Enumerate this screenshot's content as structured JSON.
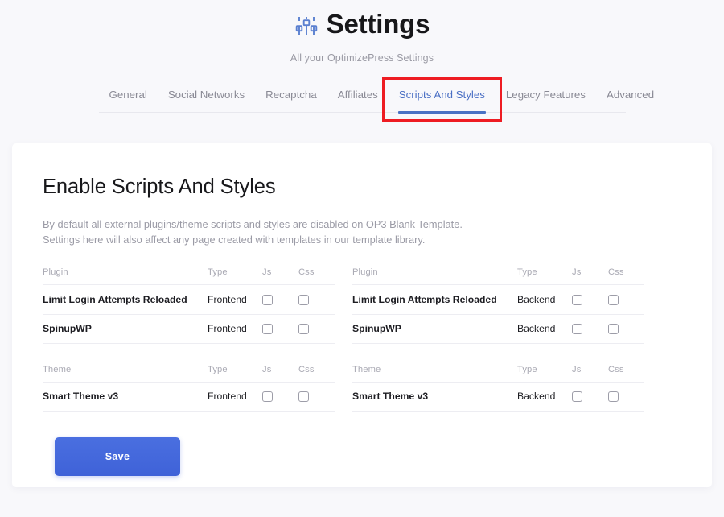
{
  "header": {
    "icon": "sliders-icon",
    "title": "Settings",
    "subtitle": "All your OptimizePress Settings"
  },
  "tabs": [
    {
      "label": "General",
      "active": false
    },
    {
      "label": "Social Networks",
      "active": false
    },
    {
      "label": "Recaptcha",
      "active": false
    },
    {
      "label": "Affiliates",
      "active": false
    },
    {
      "label": "Scripts And Styles",
      "active": true
    },
    {
      "label": "Legacy Features",
      "active": false
    },
    {
      "label": "Advanced",
      "active": false
    }
  ],
  "highlight": {
    "target_tab": "Scripts And Styles",
    "color": "#ee1c23"
  },
  "main": {
    "section_title": "Enable Scripts And Styles",
    "description_line1": "By default all external plugins/theme scripts and styles are disabled on OP3 Blank Template.",
    "description_line2": "Settings here will also affect any page created with templates in our template library.",
    "save_label": "Save",
    "columns": {
      "left": {
        "plugin_table": {
          "headers": [
            "Plugin",
            "Type",
            "Js",
            "Css"
          ],
          "rows": [
            {
              "name": "Limit Login Attempts Reloaded",
              "type": "Frontend",
              "js": false,
              "css": false
            },
            {
              "name": "SpinupWP",
              "type": "Frontend",
              "js": false,
              "css": false
            }
          ]
        },
        "theme_table": {
          "headers": [
            "Theme",
            "Type",
            "Js",
            "Css"
          ],
          "rows": [
            {
              "name": "Smart Theme v3",
              "type": "Frontend",
              "js": false,
              "css": false
            }
          ]
        }
      },
      "right": {
        "plugin_table": {
          "headers": [
            "Plugin",
            "Type",
            "Js",
            "Css"
          ],
          "rows": [
            {
              "name": "Limit Login Attempts Reloaded",
              "type": "Backend",
              "js": false,
              "css": false
            },
            {
              "name": "SpinupWP",
              "type": "Backend",
              "js": false,
              "css": false
            }
          ]
        },
        "theme_table": {
          "headers": [
            "Theme",
            "Type",
            "Js",
            "Css"
          ],
          "rows": [
            {
              "name": "Smart Theme v3",
              "type": "Backend",
              "js": false,
              "css": false
            }
          ]
        }
      }
    }
  },
  "colors": {
    "page_background": "#f8f8fb",
    "card_background": "#ffffff",
    "accent_blue": "#4a72c4",
    "save_button": "#4262d8",
    "highlight_red": "#ee1c23",
    "muted_text": "#9b9ba6"
  }
}
